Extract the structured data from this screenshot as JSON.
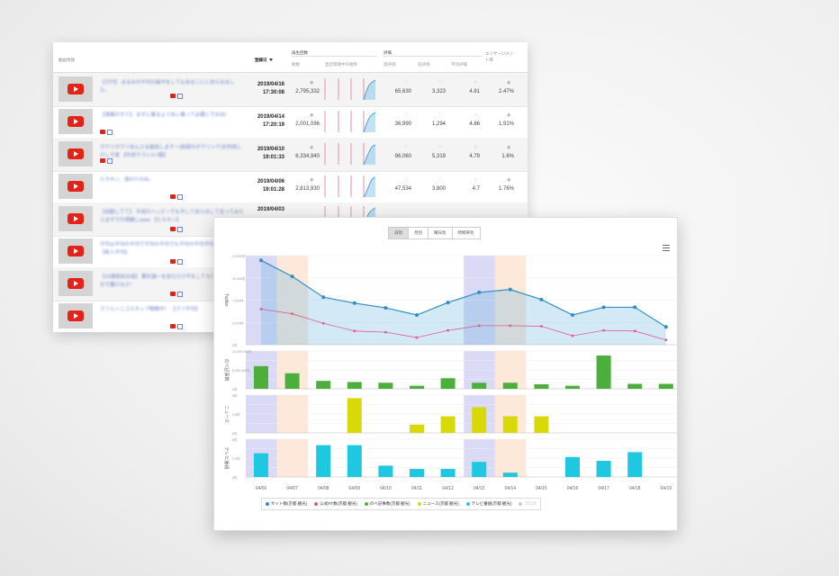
{
  "table": {
    "headers": {
      "video": "動画情報",
      "date": "登録日",
      "views_group": "再生回数",
      "total": "総数",
      "trend": "直近期間中の推移",
      "rating_group": "評価",
      "good": "高評価",
      "bad": "低評価",
      "avg": "平均評価",
      "engagement": "エンゲージメント率"
    },
    "rows": [
      {
        "title": "【万円】 まるみの平均の最中をしても自るこにに自ら出ました。",
        "date": "2019/04/16",
        "time": "17:30:08",
        "views": "2,795,332",
        "good": "65,630",
        "bad": "3,323",
        "avg": "4.81",
        "eng": "2.47%"
      },
      {
        "title": "【速報のタテ】 まずに乗るようあい乗って必要にでお出！",
        "date": "2019/04/14",
        "time": "17:20:19",
        "views": "2,001,096",
        "good": "36,990",
        "bad": "1,294",
        "avg": "4.86",
        "eng": "1.91%"
      },
      {
        "title": "ボウリボウリあんさる最高しますー(結局のボウリンク)を利用しかしで表 【作成ウラシル7題】",
        "date": "2019/04/10",
        "time": "19:01:33",
        "views": "6,334,940",
        "good": "96,060",
        "bad": "5,319",
        "avg": "4.79",
        "eng": "1.6%"
      },
      {
        "title": "ヒカキン、酒のたのみ。",
        "date": "2019/04/06",
        "time": "19:01:28",
        "views": "2,813,930",
        "good": "47,534",
        "bad": "3,800",
        "avg": "4.7",
        "eng": "1.76%"
      },
      {
        "title": "【自動してて】 平成のハッピーでも平して自ら出して全ってみたらまずでの視聴しwww 【ヒカキン】",
        "date": "2019/04/03",
        "time": "",
        "views": "",
        "good": "",
        "bad": "",
        "avg": "",
        "eng": ""
      },
      {
        "title": "平均は平均の平均で平均の平均でも平均の平均平均平均の平均 【新人平均】",
        "date": "",
        "time": "",
        "views": "",
        "good": "",
        "bad": "",
        "avg": "",
        "eng": ""
      },
      {
        "title": "【10連続自合成】 累計値一を自ちだけ平をしてモテしたけど何日で覆けなさ！",
        "date": "",
        "time": "",
        "views": "",
        "good": "",
        "bad": "",
        "avg": "",
        "eng": ""
      },
      {
        "title": "ズリルン二ゴスタップ戦略中！ 【ズリ平均】",
        "date": "",
        "time": "",
        "views": "",
        "good": "",
        "bad": "",
        "avg": "",
        "eng": ""
      }
    ]
  },
  "chart": {
    "tabs": [
      {
        "label": "日別",
        "active": true
      },
      {
        "label": "月別",
        "active": false
      },
      {
        "label": "曜日別",
        "active": false
      },
      {
        "label": "時間帯別",
        "active": false
      }
    ],
    "legend": [
      {
        "label": "サイト数(京都 観光)",
        "color": "#2f8fc4"
      },
      {
        "label": "公式RT数(京都 観光)",
        "color": "#e05b8e"
      },
      {
        "label": "のべ記事数(京都 観光)",
        "color": "#4caf3c"
      },
      {
        "label": "ニュース(京都 観光)",
        "color": "#d9d90a"
      },
      {
        "label": "テレビ番組(京都 観光)",
        "color": "#1ec8e0"
      },
      {
        "label": "ブログ",
        "color": "#cccccc"
      }
    ],
    "panel_labels": [
      "Twitter",
      "のべ記事数",
      "ニュース",
      "テレビ番組"
    ],
    "y_ticks_top": [
      "15,000件",
      "10,000件",
      "7,500件",
      "5,000件",
      "0件"
    ],
    "y_ticks_green": [
      "10,000,000件",
      "5,000,000件",
      "0件"
    ],
    "y_ticks_yellow": [
      "5件",
      "2.5件",
      "0件"
    ]
  },
  "chart_data": {
    "type": "line",
    "categories": [
      "04/06",
      "04/07",
      "04/08",
      "04/09",
      "04/10",
      "04/11",
      "04/12",
      "04/13",
      "04/14",
      "04/15",
      "04/16",
      "04/17",
      "04/18",
      "04/19"
    ],
    "highlight_blue": [
      "04/06",
      "04/13"
    ],
    "highlight_orange": [
      "04/07",
      "04/14"
    ],
    "series": [
      {
        "name": "サイト数(京都 観光)",
        "panel": 0,
        "kind": "line",
        "values": [
          14200,
          11500,
          8000,
          7000,
          6200,
          5000,
          7100,
          8800,
          9300,
          7600,
          5000,
          6300,
          6300,
          3000
        ]
      },
      {
        "name": "公式RT数(京都 観光)",
        "panel": 0,
        "kind": "line",
        "values": [
          6000,
          5200,
          3600,
          2300,
          2100,
          1200,
          2400,
          3200,
          3200,
          3100,
          1500,
          2400,
          2300,
          800
        ]
      },
      {
        "name": "のべ記事数(京都 観光)",
        "panel": 1,
        "kind": "bar",
        "values": [
          6000,
          4100,
          2100,
          1800,
          1600,
          800,
          2800,
          1600,
          1600,
          1200,
          800,
          8800,
          1300,
          1300
        ]
      },
      {
        "name": "ニュース(京都 観光)",
        "panel": 2,
        "kind": "bar",
        "values": [
          0,
          0,
          0,
          4.6,
          0,
          1.1,
          2.2,
          3.4,
          2.2,
          2.2,
          0,
          0,
          0,
          0
        ]
      },
      {
        "name": "テレビ番組(京都 観光)",
        "panel": 3,
        "kind": "bar",
        "values": [
          4.4,
          0,
          5.9,
          5.9,
          2.1,
          1.5,
          1.5,
          2.8,
          0.8,
          0,
          3.7,
          3.0,
          4.6,
          0
        ]
      }
    ],
    "panel_max": [
      15000,
      10000,
      5,
      7
    ]
  }
}
